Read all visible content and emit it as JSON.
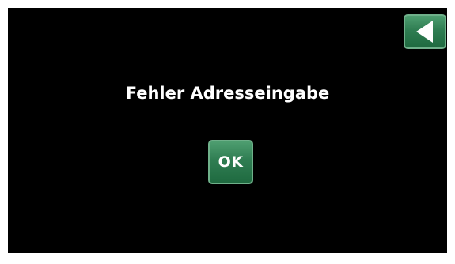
{
  "dialog": {
    "message": "Fehler Adresseingabe",
    "ok_label": "OK"
  },
  "icons": {
    "back": "back-arrow-icon"
  },
  "colors": {
    "screen_background": "#000000",
    "button_green": "#2f7d52",
    "button_border": "#6fb08a",
    "text": "#ffffff"
  }
}
